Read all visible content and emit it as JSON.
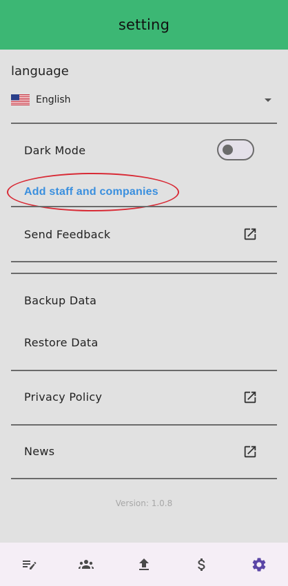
{
  "appbar": {
    "title": "setting",
    "color": "#3cb774"
  },
  "language": {
    "heading": "language",
    "selected": "English",
    "flag_icon": "us-flag-icon"
  },
  "settings": {
    "dark_mode_label": "Dark Mode",
    "dark_mode_enabled": false,
    "add_staff_label": "Add staff and companies",
    "send_feedback_label": "Send Feedback",
    "backup_label": "Backup Data",
    "restore_label": "Restore Data",
    "privacy_label": "Privacy Policy",
    "news_label": "News"
  },
  "version_text": "Version: 1.0.8",
  "bottom_nav": {
    "items": [
      {
        "icon": "edit-list-icon"
      },
      {
        "icon": "people-icon"
      },
      {
        "icon": "upload-icon"
      },
      {
        "icon": "dollar-icon"
      },
      {
        "icon": "gear-icon",
        "active": true
      }
    ],
    "active_color": "#5a45a6",
    "inactive_color": "#4a4a4a"
  }
}
